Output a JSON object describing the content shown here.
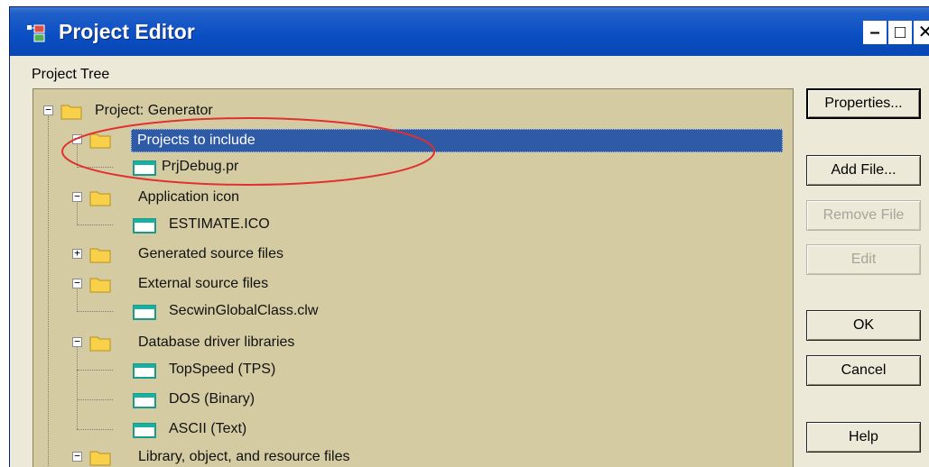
{
  "window": {
    "title": "Project Editor",
    "minimize_glyph": "–",
    "maximize_glyph": "□",
    "close_glyph": "✕"
  },
  "tree": {
    "label": "Project Tree",
    "label_underline_char": "T",
    "nodes": [
      {
        "label": "Project: Generator",
        "type": "folder",
        "expander": "−",
        "selected": false
      },
      {
        "label": "Projects to include",
        "type": "folder",
        "expander": "−",
        "selected": true
      },
      {
        "label": "PrjDebug.pr",
        "type": "file"
      },
      {
        "label": "Application icon",
        "type": "folder",
        "expander": "−"
      },
      {
        "label": "ESTIMATE.ICO",
        "type": "file"
      },
      {
        "label": "Generated source files",
        "type": "folder",
        "expander": "+"
      },
      {
        "label": "External source files",
        "type": "folder",
        "expander": "−"
      },
      {
        "label": "SecwinGlobalClass.clw",
        "type": "file"
      },
      {
        "label": "Database driver libraries",
        "type": "folder",
        "expander": "−"
      },
      {
        "label": "TopSpeed (TPS)",
        "type": "file"
      },
      {
        "label": "DOS (Binary)",
        "type": "file"
      },
      {
        "label": "ASCII (Text)",
        "type": "file"
      },
      {
        "label": "Library, object, and resource files",
        "type": "folder",
        "expander": "−"
      }
    ]
  },
  "buttons": {
    "properties": "Properties...",
    "add_file": "Add File...",
    "remove_file": "Remove File",
    "edit": "Edit",
    "ok": "OK",
    "cancel": "Cancel",
    "help": "Help"
  },
  "colors": {
    "titlebar": "#0a4ec4",
    "tree_background": "#d5cba2",
    "selection": "#2f5ba6",
    "annotation_ellipse": "#e03030"
  }
}
